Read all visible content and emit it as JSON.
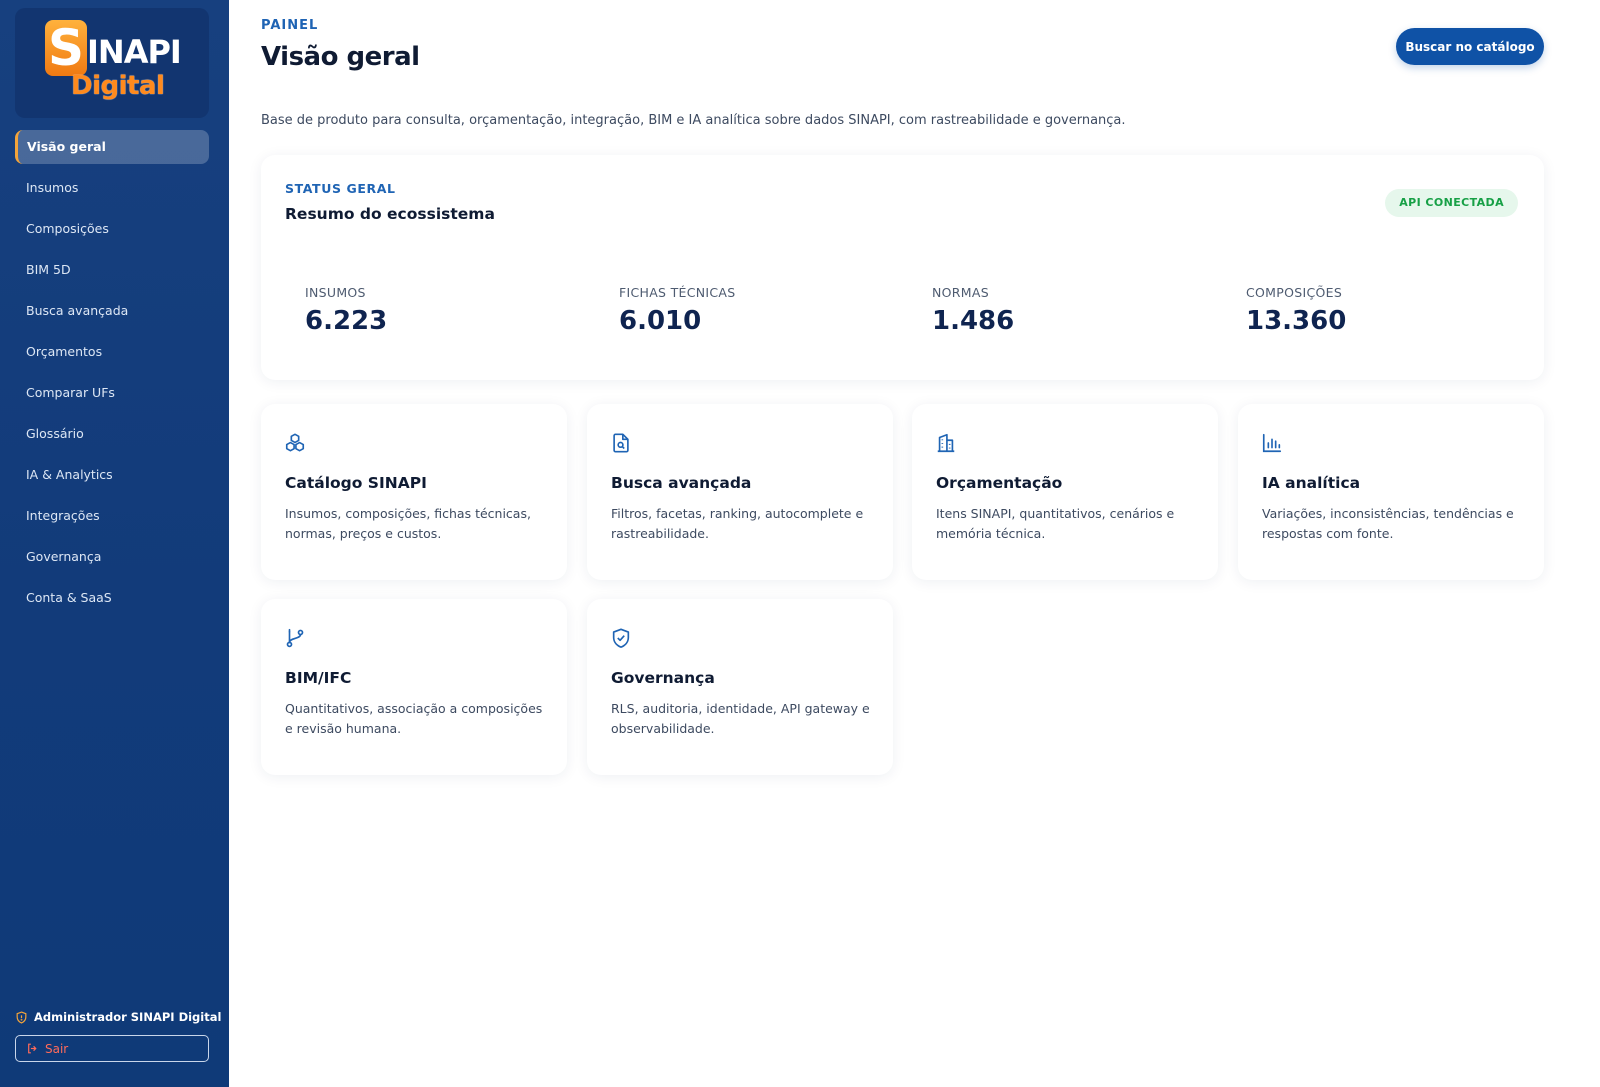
{
  "brand": {
    "logo_initial": "S",
    "logo_rest": "INAPI",
    "logo_sub": "Digital"
  },
  "sidebar": {
    "items": [
      {
        "label": "Visão geral",
        "active": true
      },
      {
        "label": "Insumos"
      },
      {
        "label": "Composições"
      },
      {
        "label": "BIM 5D"
      },
      {
        "label": "Busca avançada"
      },
      {
        "label": "Orçamentos"
      },
      {
        "label": "Comparar UFs"
      },
      {
        "label": "Glossário"
      },
      {
        "label": "IA & Analytics"
      },
      {
        "label": "Integrações"
      },
      {
        "label": "Governança"
      },
      {
        "label": "Conta & SaaS"
      }
    ],
    "user_label": "Administrador SINAPI Digital",
    "user_icon": "shield-icon",
    "logout_label": "Sair",
    "logout_icon": "logout-icon"
  },
  "header": {
    "eyebrow": "PAINEL",
    "title": "Visão geral",
    "cta_label": "Buscar no catálogo",
    "description": "Base de produto para consulta, orçamentação, integração, BIM e IA analítica sobre dados SINAPI, com rastreabilidade e governança."
  },
  "status": {
    "eyebrow": "STATUS GERAL",
    "title": "Resumo do ecossistema",
    "badge": "API CONECTADA",
    "stats": [
      {
        "label": "INSUMOS",
        "value": "6.223"
      },
      {
        "label": "FICHAS TÉCNICAS",
        "value": "6.010"
      },
      {
        "label": "NORMAS",
        "value": "1.486"
      },
      {
        "label": "COMPOSIÇÕES",
        "value": "13.360"
      }
    ]
  },
  "cards": [
    {
      "icon": "cubes-icon",
      "title": "Catálogo SINAPI",
      "desc": "Insumos, composições, fichas técnicas, normas, preços e custos."
    },
    {
      "icon": "file-search-icon",
      "title": "Busca avançada",
      "desc": "Filtros, facetas, ranking, autocomplete e rastreabilidade."
    },
    {
      "icon": "building-icon",
      "title": "Orçamentação",
      "desc": "Itens SINAPI, quantitativos, cenários e memória técnica."
    },
    {
      "icon": "bar-chart-icon",
      "title": "IA analítica",
      "desc": "Variações, inconsistências, tendências e respostas com fonte."
    },
    {
      "icon": "git-branch-icon",
      "title": "BIM/IFC",
      "desc": "Quantitativos, associação a composições e revisão humana."
    },
    {
      "icon": "shield-check-icon",
      "title": "Governança",
      "desc": "RLS, auditoria, identidade, API gateway e observabilidade."
    }
  ],
  "colors": {
    "sidebar_bg": "#17407f",
    "accent_blue": "#0f52a6",
    "brand_orange": "#f07a12",
    "success_green": "#17a046",
    "danger_red": "#ff6b5a"
  }
}
